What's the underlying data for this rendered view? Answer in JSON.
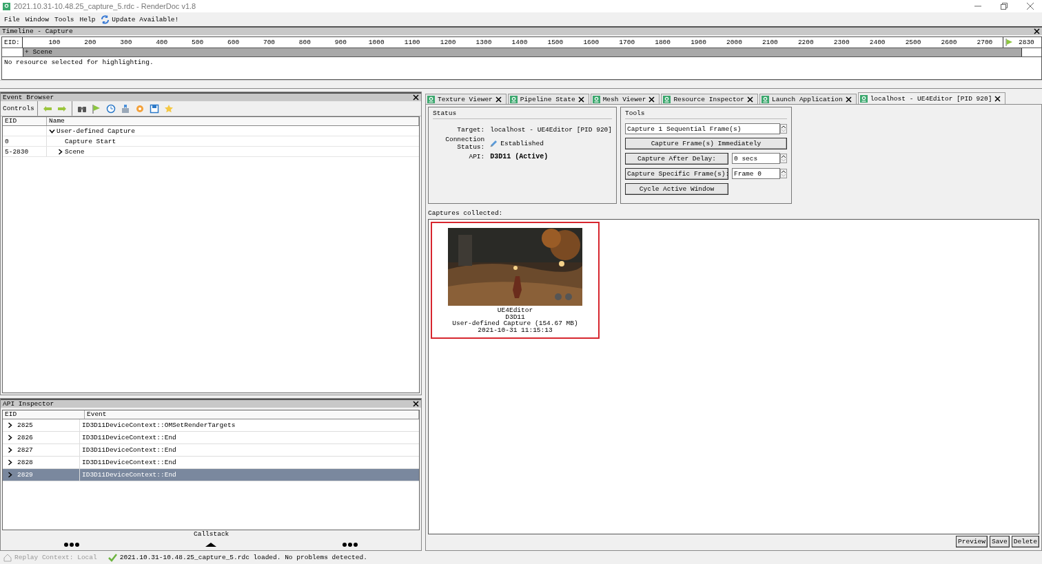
{
  "window": {
    "title": "2021.10.31-10.48.25_capture_5.rdc - RenderDoc v1.8"
  },
  "menu": [
    {
      "label": "File"
    },
    {
      "label": "Window"
    },
    {
      "label": "Tools"
    },
    {
      "label": "Help"
    }
  ],
  "update_notice": "Update Available!",
  "timeline": {
    "title": "Timeline - Capture",
    "eid_label": "EID:",
    "ticks": [
      "100",
      "200",
      "300",
      "400",
      "500",
      "600",
      "700",
      "800",
      "900",
      "1000",
      "1100",
      "1200",
      "1300",
      "1400",
      "1500",
      "1600",
      "1700",
      "1800",
      "1900",
      "2000",
      "2100",
      "2200",
      "2300",
      "2400",
      "2500",
      "2600",
      "2700"
    ],
    "end_marker": "2830",
    "section": "+ Scene",
    "note": "No resource selected for highlighting."
  },
  "event_browser": {
    "title": "Event Browser",
    "controls_label": "Controls",
    "columns": [
      "EID",
      "Name"
    ],
    "rows": [
      {
        "kind": "group",
        "eid": "",
        "name": "User-defined Capture",
        "expanded": true,
        "children": [
          {
            "kind": "event",
            "eid": "0",
            "name": "Capture Start"
          },
          {
            "kind": "group",
            "eid": "5-2830",
            "name": "Scene",
            "expanded": false
          }
        ]
      }
    ]
  },
  "api_inspector": {
    "title": "API Inspector",
    "columns": [
      "EID",
      "Event"
    ],
    "rows": [
      {
        "eid": "2825",
        "event": "ID3D11DeviceContext::OMSetRenderTargets",
        "selected": false
      },
      {
        "eid": "2826",
        "event": "ID3D11DeviceContext::End",
        "selected": false
      },
      {
        "eid": "2827",
        "event": "ID3D11DeviceContext::End",
        "selected": false
      },
      {
        "eid": "2828",
        "event": "ID3D11DeviceContext::End",
        "selected": false
      },
      {
        "eid": "2829",
        "event": "ID3D11DeviceContext::End",
        "selected": true
      }
    ],
    "callstack_label": "Callstack"
  },
  "tabs": [
    {
      "label": "Texture Viewer",
      "selected": false
    },
    {
      "label": "Pipeline State",
      "selected": false
    },
    {
      "label": "Mesh Viewer",
      "selected": false
    },
    {
      "label": "Resource Inspector",
      "selected": false
    },
    {
      "label": "Launch Application",
      "selected": false
    },
    {
      "label": "localhost - UE4Editor [PID 920]",
      "selected": true
    }
  ],
  "status": {
    "title": "Status",
    "fields": [
      {
        "kind": "plain",
        "label": "Target:",
        "value": "localhost - UE4Editor [PID 920]"
      },
      {
        "kind": "icon",
        "label": "Connection Status:",
        "value": "Established"
      },
      {
        "kind": "bold",
        "label": "API:",
        "value": "D3D11 (Active)"
      }
    ]
  },
  "tools": {
    "title": "Tools",
    "sequential": "Capture 1 Sequential Frame(s)",
    "immediate": "Capture Frame(s) Immediately",
    "delay_button": "Capture After Delay:",
    "delay_value": "0 secs",
    "specific_button": "Capture Specific Frame(s):",
    "specific_value": "Frame 0",
    "cycle": "Cycle Active Window"
  },
  "captures": {
    "label": "Captures collected:",
    "items": [
      {
        "kind": "picture",
        "selected": true,
        "lines": [
          "UE4Editor",
          "D3D11",
          "User-defined Capture (154.67 MB)",
          "2021-10-31 11:15:13"
        ]
      }
    ],
    "buttons": [
      "Preview",
      "Save",
      "Delete"
    ]
  },
  "status_bar": {
    "replay_context": "Replay Context: Local",
    "message": "2021.10.31-10.48.25_capture_5.rdc loaded. No problems detected."
  }
}
